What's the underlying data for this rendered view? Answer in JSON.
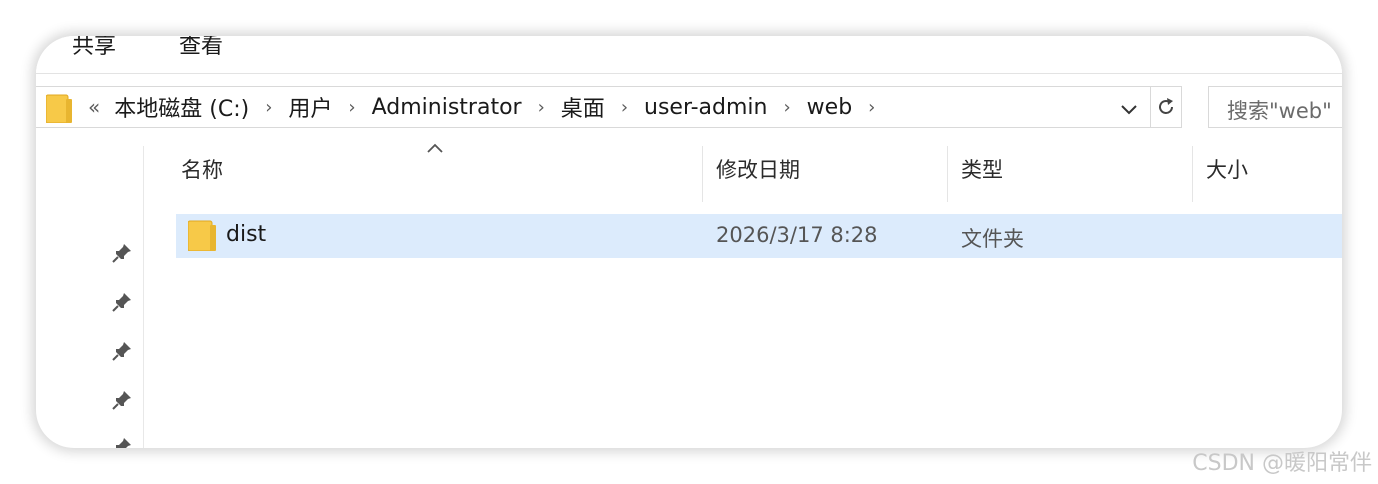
{
  "ribbon": {
    "tabs": [
      "共享",
      "查看"
    ]
  },
  "address_bar": {
    "overflow_glyph": "«",
    "crumbs": [
      "本地磁盘 (C:)",
      "用户",
      "Administrator",
      "桌面",
      "user-admin",
      "web"
    ],
    "separator": "›"
  },
  "search": {
    "placeholder": "搜索\"web\""
  },
  "columns": {
    "name": "名称",
    "date": "修改日期",
    "type": "类型",
    "size": "大小"
  },
  "files": [
    {
      "name": "dist",
      "modified": "2026/3/17 8:28",
      "type": "文件夹",
      "size": "",
      "selected": true,
      "icon": "folder-icon"
    }
  ],
  "nav_pins": 5,
  "watermark": "CSDN @暖阳常伴",
  "colors": {
    "selection": "#dcebfc",
    "folder": "#f7c948",
    "folder_dark": "#e0a820"
  }
}
